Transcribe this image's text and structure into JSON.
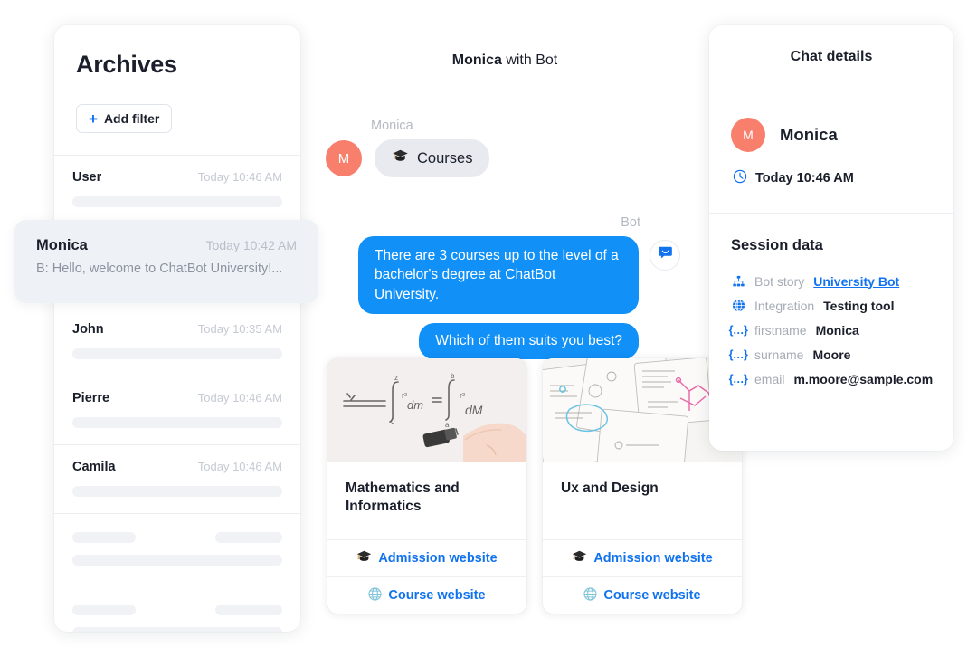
{
  "archives": {
    "title": "Archives",
    "add_filter_label": "Add filter",
    "add_filter_icon": "plus-icon",
    "rows": [
      {
        "name": "User",
        "time": "Today 10:46 AM"
      },
      {
        "name": "John",
        "time": "Today 10:35 AM"
      },
      {
        "name": "Pierre",
        "time": "Today 10:46 AM"
      },
      {
        "name": "Camila",
        "time": "Today 10:46 AM"
      }
    ],
    "selected": {
      "name": "Monica",
      "time": "Today 10:42 AM",
      "preview": "B: Hello, welcome to ChatBot University!..."
    }
  },
  "conversation": {
    "header_name": "Monica",
    "header_rest": " with Bot",
    "user_message": {
      "author": "Monica",
      "avatar_initial": "M",
      "icon": "graduation-cap-icon",
      "text": "Courses"
    },
    "bot_messages": {
      "author": "Bot",
      "avatar_icon": "chat-bubble-icon",
      "first": "There are 3 courses up to the level of a bachelor's degree at ChatBot University.",
      "second": "Which of them suits you best?"
    },
    "cards": [
      {
        "title": "Mathematics and Informatics",
        "image": "whiteboard-math-photo",
        "admission_label": "Admission website",
        "admission_icon": "graduation-cap-icon",
        "course_label": "Course website",
        "course_icon": "globe-icon"
      },
      {
        "title": "Ux and Design",
        "image": "ux-sketches-photo",
        "admission_label": "Admission website",
        "admission_icon": "graduation-cap-icon",
        "course_label": "Course website",
        "course_icon": "globe-icon"
      }
    ]
  },
  "details": {
    "title": "Chat details",
    "user_name": "Monica",
    "avatar_initial": "M",
    "time": "Today 10:46 AM",
    "time_icon": "clock-icon",
    "session_title": "Session data",
    "session_items": [
      {
        "icon": "sitemap-icon",
        "key": "Bot story",
        "value": "University Bot",
        "link": true
      },
      {
        "icon": "globe-icon",
        "key": "Integration",
        "value": "Testing tool",
        "link": false
      },
      {
        "icon": "braces-icon",
        "key": "firstname",
        "value": "Monica",
        "link": false
      },
      {
        "icon": "braces-icon",
        "key": "surname",
        "value": "Moore",
        "link": false
      },
      {
        "icon": "braces-icon",
        "key": "email",
        "value": "m.moore@sample.com",
        "link": false
      }
    ]
  },
  "colors": {
    "accent_blue": "#1172f0",
    "bubble_blue": "#1190f7",
    "avatar_coral": "#f97f6d",
    "selected_row": "#eef2f6",
    "user_bubble": "#e8eaf0"
  }
}
